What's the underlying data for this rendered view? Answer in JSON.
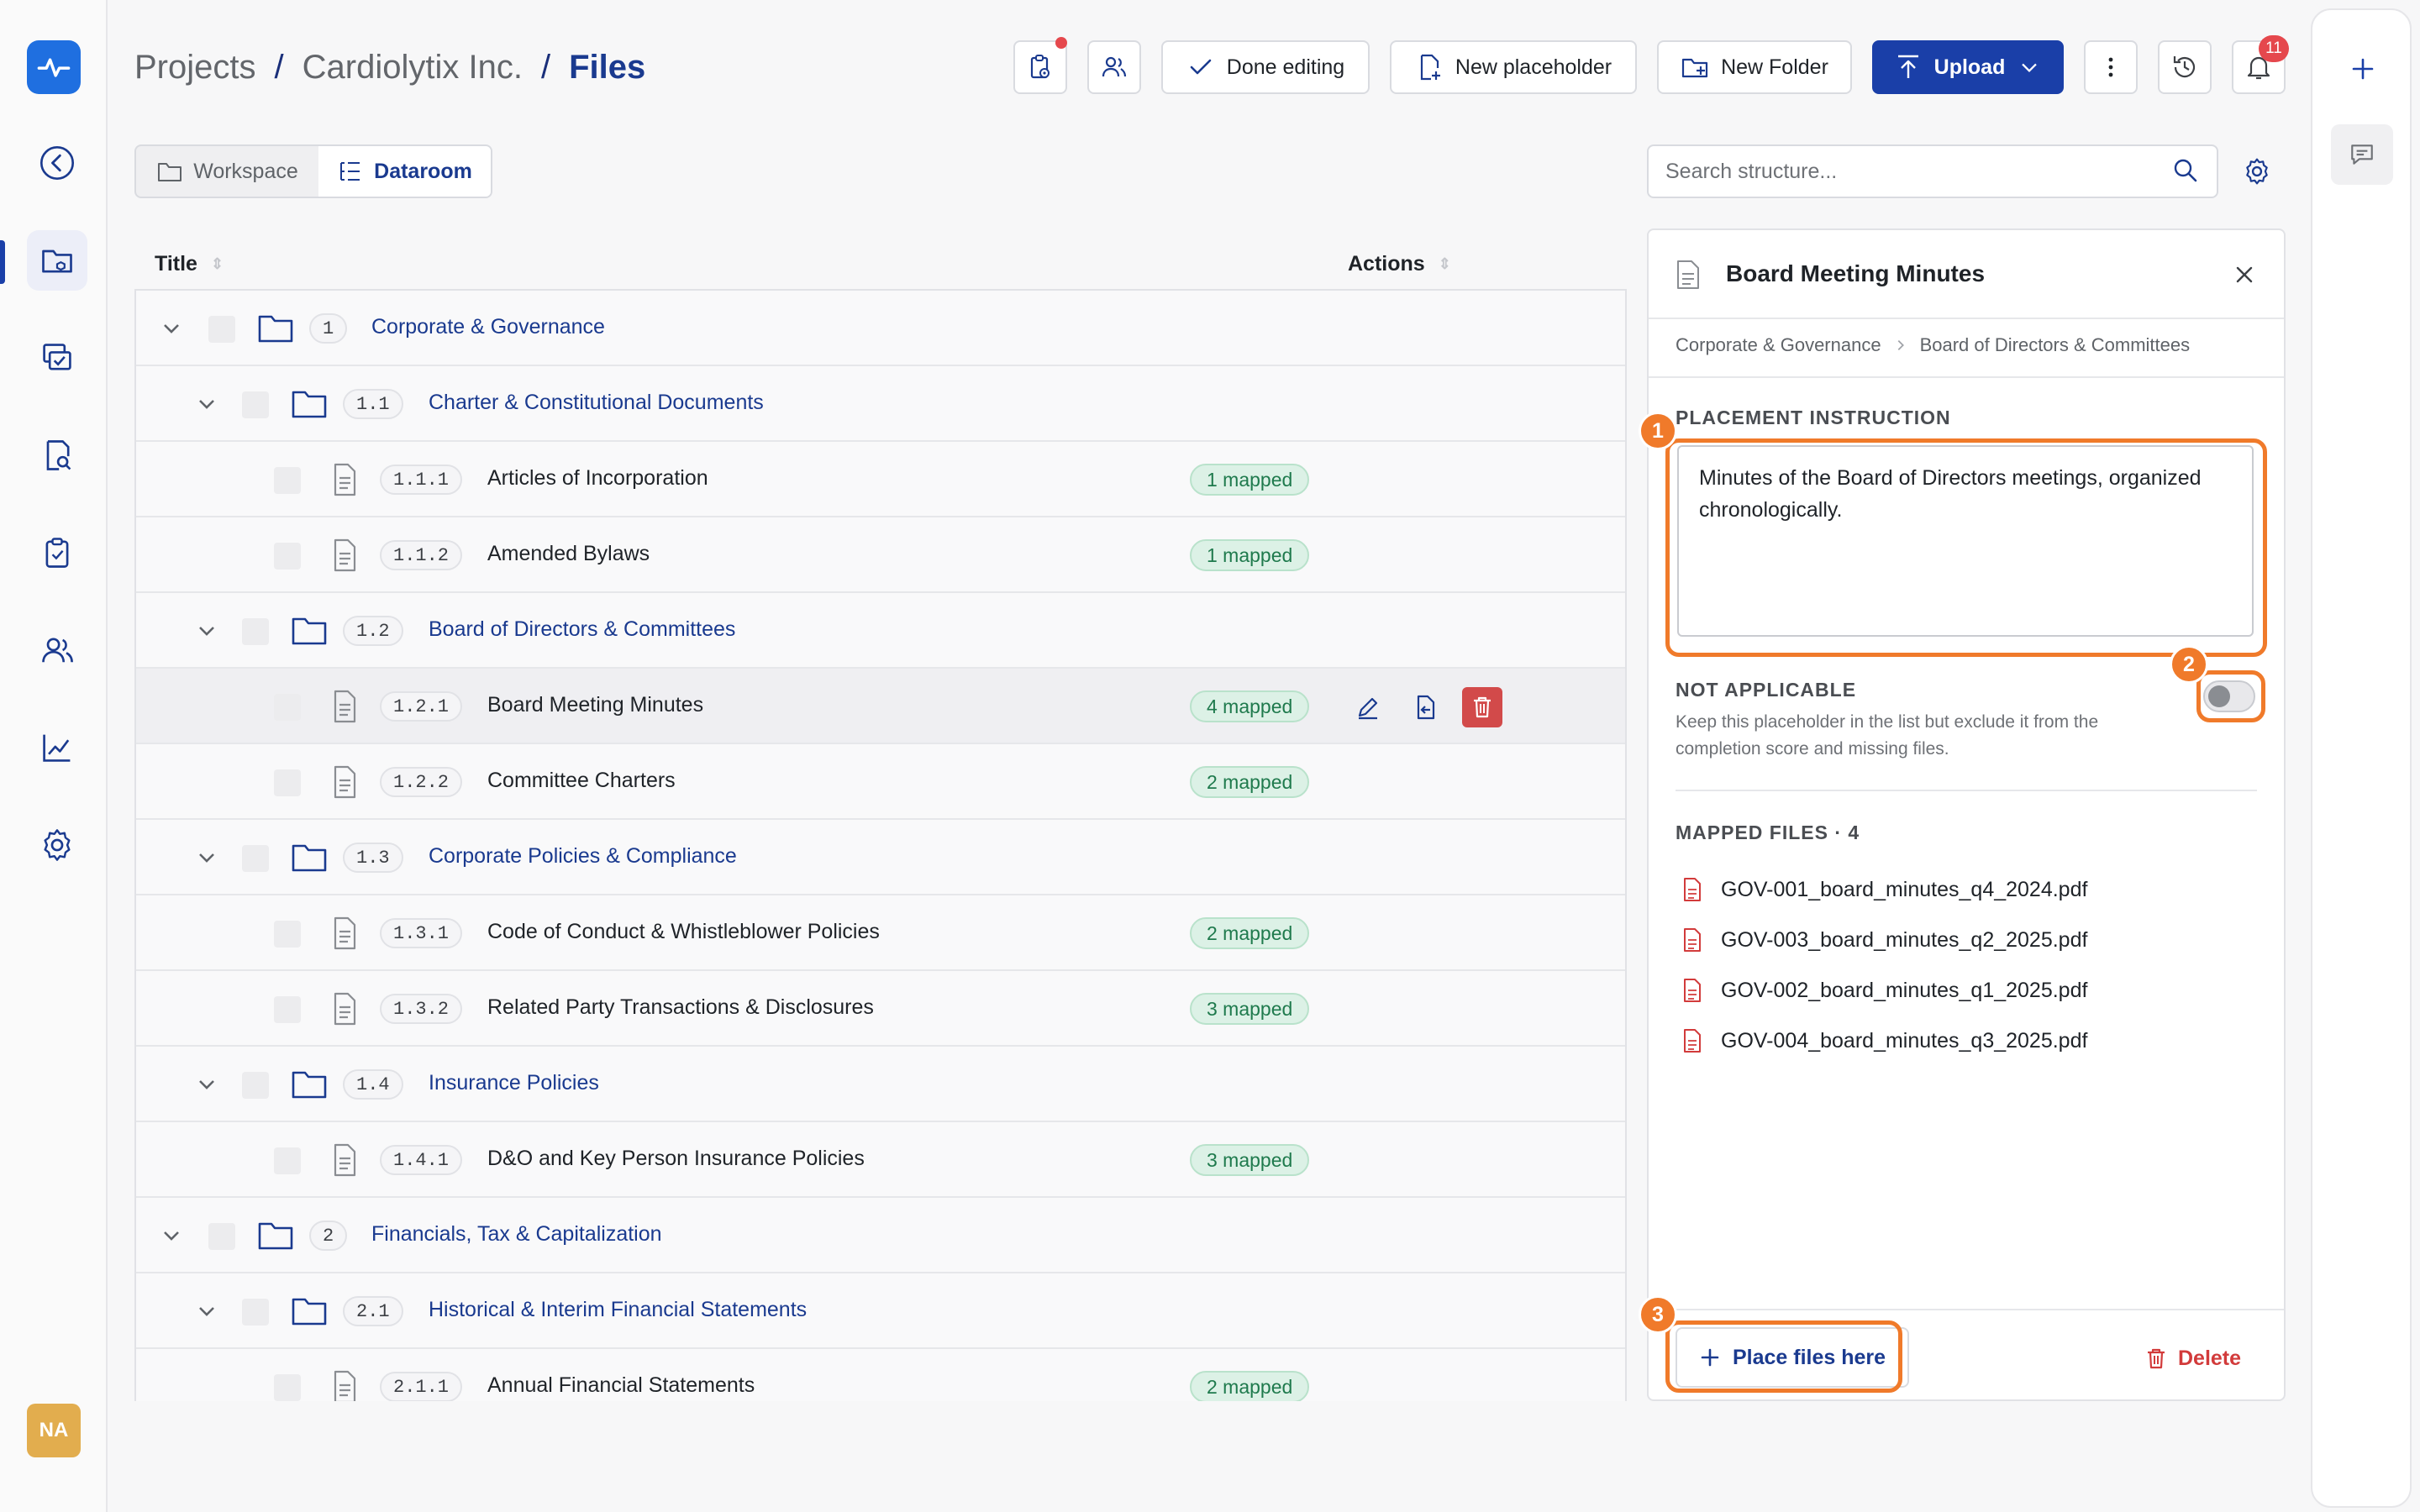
{
  "breadcrumb": {
    "items": [
      "Projects",
      "Cardiolytix Inc.",
      "Files"
    ],
    "separator": "/"
  },
  "toolbar": {
    "done_editing": "Done editing",
    "new_placeholder": "New placeholder",
    "new_folder": "New Folder",
    "upload": "Upload",
    "notifications_count": "11"
  },
  "view_switch": {
    "workspace": "Workspace",
    "dataroom": "Dataroom",
    "selected": "Dataroom"
  },
  "table": {
    "headers": {
      "title": "Title",
      "actions": "Actions"
    },
    "rows": [
      {
        "kind": "folder",
        "level": 0,
        "num": "1",
        "title": "Corporate & Governance"
      },
      {
        "kind": "folder",
        "level": 1,
        "num": "1.1",
        "title": "Charter & Constitutional Documents"
      },
      {
        "kind": "doc",
        "level": 2,
        "num": "1.1.1",
        "title": "Articles of Incorporation",
        "badge": "1 mapped"
      },
      {
        "kind": "doc",
        "level": 2,
        "num": "1.1.2",
        "title": "Amended Bylaws",
        "badge": "1 mapped"
      },
      {
        "kind": "folder",
        "level": 1,
        "num": "1.2",
        "title": "Board of Directors & Committees"
      },
      {
        "kind": "doc",
        "level": 2,
        "num": "1.2.1",
        "title": "Board Meeting Minutes",
        "badge": "4 mapped",
        "selected": true
      },
      {
        "kind": "doc",
        "level": 2,
        "num": "1.2.2",
        "title": "Committee Charters",
        "badge": "2 mapped"
      },
      {
        "kind": "folder",
        "level": 1,
        "num": "1.3",
        "title": "Corporate Policies & Compliance"
      },
      {
        "kind": "doc",
        "level": 2,
        "num": "1.3.1",
        "title": "Code of Conduct & Whistleblower Policies",
        "badge": "2 mapped"
      },
      {
        "kind": "doc",
        "level": 2,
        "num": "1.3.2",
        "title": "Related Party Transactions & Disclosures",
        "badge": "3 mapped"
      },
      {
        "kind": "folder",
        "level": 1,
        "num": "1.4",
        "title": "Insurance Policies"
      },
      {
        "kind": "doc",
        "level": 2,
        "num": "1.4.1",
        "title": "D&O and Key Person Insurance Policies",
        "badge": "3 mapped"
      },
      {
        "kind": "folder",
        "level": 0,
        "num": "2",
        "title": "Financials, Tax & Capitalization"
      },
      {
        "kind": "folder",
        "level": 1,
        "num": "2.1",
        "title": "Historical & Interim Financial Statements"
      },
      {
        "kind": "doc",
        "level": 2,
        "num": "2.1.1",
        "title": "Annual Financial Statements",
        "badge": "2 mapped"
      }
    ]
  },
  "search": {
    "placeholder": "Search structure..."
  },
  "panel": {
    "title": "Board Meeting Minutes",
    "crumb": [
      "Corporate & Governance",
      "Board of Directors & Committees"
    ],
    "placement_label": "PLACEMENT INSTRUCTION",
    "placement_text": "Minutes of the Board of Directors meetings, organized chronologically.",
    "na_label": "NOT APPLICABLE",
    "na_desc": "Keep this placeholder in the list but exclude it from the completion score and missing files.",
    "na_enabled": false,
    "mapped_label": "MAPPED FILES · 4",
    "mapped_files": [
      "GOV-001_board_minutes_q4_2024.pdf",
      "GOV-003_board_minutes_q2_2025.pdf",
      "GOV-002_board_minutes_q1_2025.pdf",
      "GOV-004_board_minutes_q3_2025.pdf"
    ],
    "place_files": "Place files here",
    "delete": "Delete"
  },
  "avatar": "NA",
  "highlights": [
    "1",
    "2",
    "3"
  ],
  "colors": {
    "accent": "#1a3fa8",
    "highlight": "#f07a2a",
    "mapped_bg": "#dcf1e6",
    "danger": "#d24a4a"
  }
}
